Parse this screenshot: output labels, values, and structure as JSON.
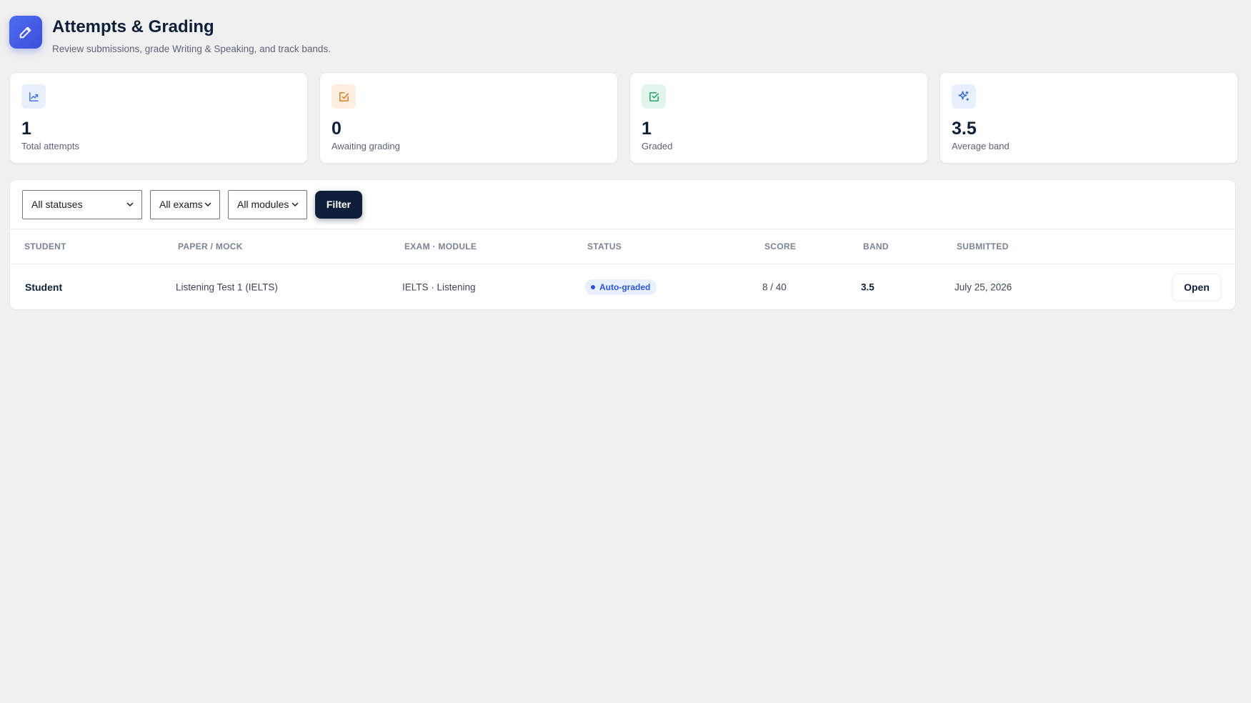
{
  "header": {
    "title": "Attempts & Grading",
    "subtitle": "Review submissions, grade Writing & Speaking, and track bands.",
    "icon": "pencil-icon",
    "accent": "#4f6cf0"
  },
  "stats": [
    {
      "value": "1",
      "label": "Total attempts",
      "icon": "trend-chart-icon",
      "color": "#3b6fe0"
    },
    {
      "value": "0",
      "label": "Awaiting grading",
      "icon": "edit-box-icon",
      "color": "#d9731a"
    },
    {
      "value": "1",
      "label": "Graded",
      "icon": "check-box-icon",
      "color": "#1a9a5e"
    },
    {
      "value": "3.5",
      "label": "Average band",
      "icon": "sparkle-icon",
      "color": "#3b6fe0"
    }
  ],
  "filters": {
    "status": "All statuses",
    "exam": "All exams",
    "module": "All modules",
    "button": "Filter"
  },
  "table": {
    "columns": [
      "STUDENT",
      "PAPER / MOCK",
      "EXAM · MODULE",
      "STATUS",
      "SCORE",
      "BAND",
      "SUBMITTED"
    ],
    "rows": [
      {
        "student": "Student",
        "paper": "Listening Test 1 (IELTS)",
        "exam_module": "IELTS · Listening",
        "status": "Auto-graded",
        "score": "8 / 40",
        "band": "3.5",
        "submitted": "July 25, 2026",
        "action": "Open"
      }
    ]
  }
}
